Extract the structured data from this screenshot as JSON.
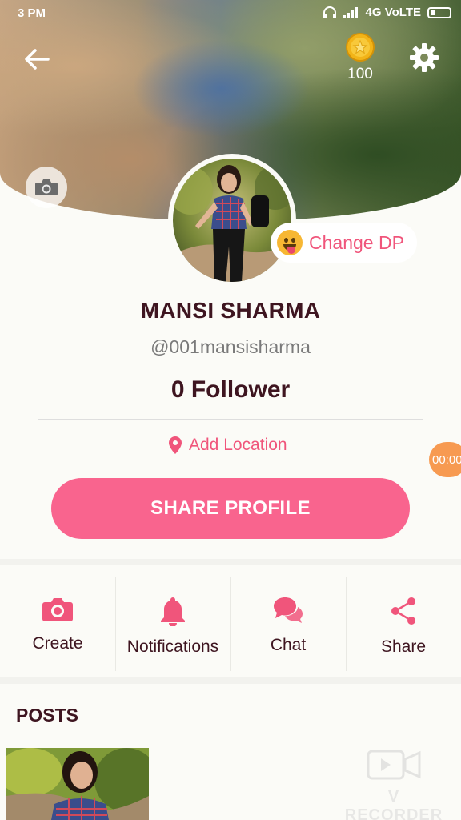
{
  "status_bar": {
    "time": "3 PM",
    "network": "4G VoLTE"
  },
  "header": {
    "back_icon": "arrow-left-icon",
    "coins": "100",
    "coin_icon": "gold-coin-icon",
    "settings_icon": "gear-icon",
    "cover_camera_icon": "camera-icon"
  },
  "profile": {
    "change_dp_label": "Change DP",
    "name": "MANSI SHARMA",
    "handle": "@001mansisharma",
    "followers": "0 Follower",
    "add_location_label": "Add Location",
    "share_profile_label": "SHARE PROFILE"
  },
  "recording_badge": "00:00",
  "actions": [
    {
      "label": "Create",
      "icon": "camera-icon"
    },
    {
      "label": "Notifications",
      "icon": "bell-icon"
    },
    {
      "label": "Chat",
      "icon": "chat-bubbles-icon"
    },
    {
      "label": "Share",
      "icon": "share-icon"
    }
  ],
  "posts": {
    "title": "POSTS"
  },
  "watermark": "V RECORDER",
  "colors": {
    "accent": "#f9648e",
    "accent_text": "#f0557b",
    "title_text": "#3e1520",
    "timer": "#f79a51"
  }
}
